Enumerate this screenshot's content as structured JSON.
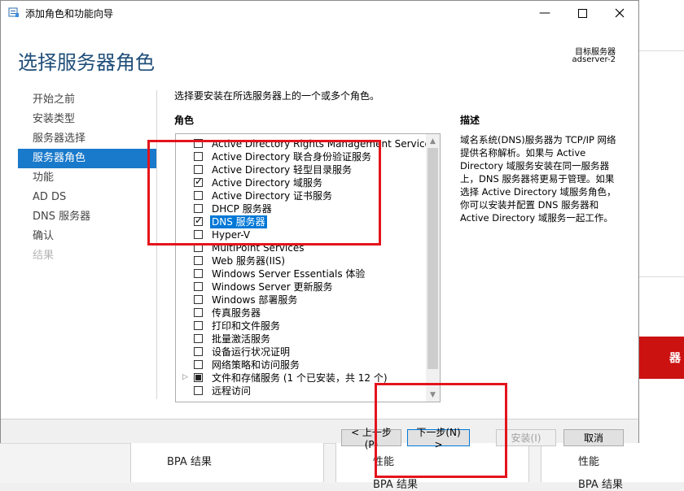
{
  "window": {
    "title": "添加角色和功能向导",
    "minimize_icon": "minimize-icon",
    "maximize_icon": "maximize-icon",
    "close_icon": "close-icon"
  },
  "header": {
    "page_title": "选择服务器角色",
    "target_label": "目标服务器",
    "target_value": "adserver-2"
  },
  "nav": {
    "items": [
      {
        "label": "开始之前",
        "state": "normal"
      },
      {
        "label": "安装类型",
        "state": "normal"
      },
      {
        "label": "服务器选择",
        "state": "normal"
      },
      {
        "label": "服务器角色",
        "state": "active"
      },
      {
        "label": "功能",
        "state": "normal"
      },
      {
        "label": "AD DS",
        "state": "normal"
      },
      {
        "label": "DNS 服务器",
        "state": "normal"
      },
      {
        "label": "确认",
        "state": "normal"
      },
      {
        "label": "结果",
        "state": "disabled"
      }
    ]
  },
  "main": {
    "instruction": "选择要安装在所选服务器上的一个或多个角色。",
    "roles_heading": "角色",
    "description_heading": "描述",
    "description": "域名系统(DNS)服务器为 TCP/IP 网络提供名称解析。如果与 Active Directory 域服务安装在同一服务器上，DNS 服务器将更易于管理。如果选择 Active Directory 域服务角色，你可以安装并配置 DNS 服务器和 Active Directory 域服务一起工作。",
    "roles": [
      {
        "label": "Active Directory Rights Management Services",
        "state": "unchecked"
      },
      {
        "label": "Active Directory 联合身份验证服务",
        "state": "unchecked"
      },
      {
        "label": "Active Directory 轻型目录服务",
        "state": "unchecked"
      },
      {
        "label": "Active Directory 域服务",
        "state": "checked"
      },
      {
        "label": "Active Directory 证书服务",
        "state": "unchecked"
      },
      {
        "label": "DHCP 服务器",
        "state": "unchecked"
      },
      {
        "label": "DNS 服务器",
        "state": "checked",
        "selected": true
      },
      {
        "label": "Hyper-V",
        "state": "unchecked"
      },
      {
        "label": "MultiPoint Services",
        "state": "unchecked"
      },
      {
        "label": "Web 服务器(IIS)",
        "state": "unchecked"
      },
      {
        "label": "Windows Server Essentials 体验",
        "state": "unchecked"
      },
      {
        "label": "Windows Server 更新服务",
        "state": "unchecked"
      },
      {
        "label": "Windows 部署服务",
        "state": "unchecked"
      },
      {
        "label": "传真服务器",
        "state": "unchecked"
      },
      {
        "label": "打印和文件服务",
        "state": "unchecked"
      },
      {
        "label": "批量激活服务",
        "state": "unchecked"
      },
      {
        "label": "设备运行状况证明",
        "state": "unchecked"
      },
      {
        "label": "网络策略和访问服务",
        "state": "unchecked"
      },
      {
        "label": "文件和存储服务 (1 个已安装，共 12 个)",
        "state": "partial",
        "expandable": true
      },
      {
        "label": "远程访问",
        "state": "unchecked"
      }
    ]
  },
  "footer": {
    "prev_label": "< 上一步(P)",
    "next_label": "下一步(N) >",
    "install_label": "安装(I)",
    "cancel_label": "取消"
  },
  "background": {
    "bpa_label": "BPA 结果",
    "perf_label_1": "性能",
    "bpa_label_2": "BPA 结果",
    "perf_label_2": "性能",
    "bpa_label_3": "BPA 结果",
    "red_glyph": "器"
  },
  "colors": {
    "accent": "#1979ca",
    "selection": "#0078d7",
    "annotation": "#e4141b",
    "title": "#1f4e79"
  }
}
